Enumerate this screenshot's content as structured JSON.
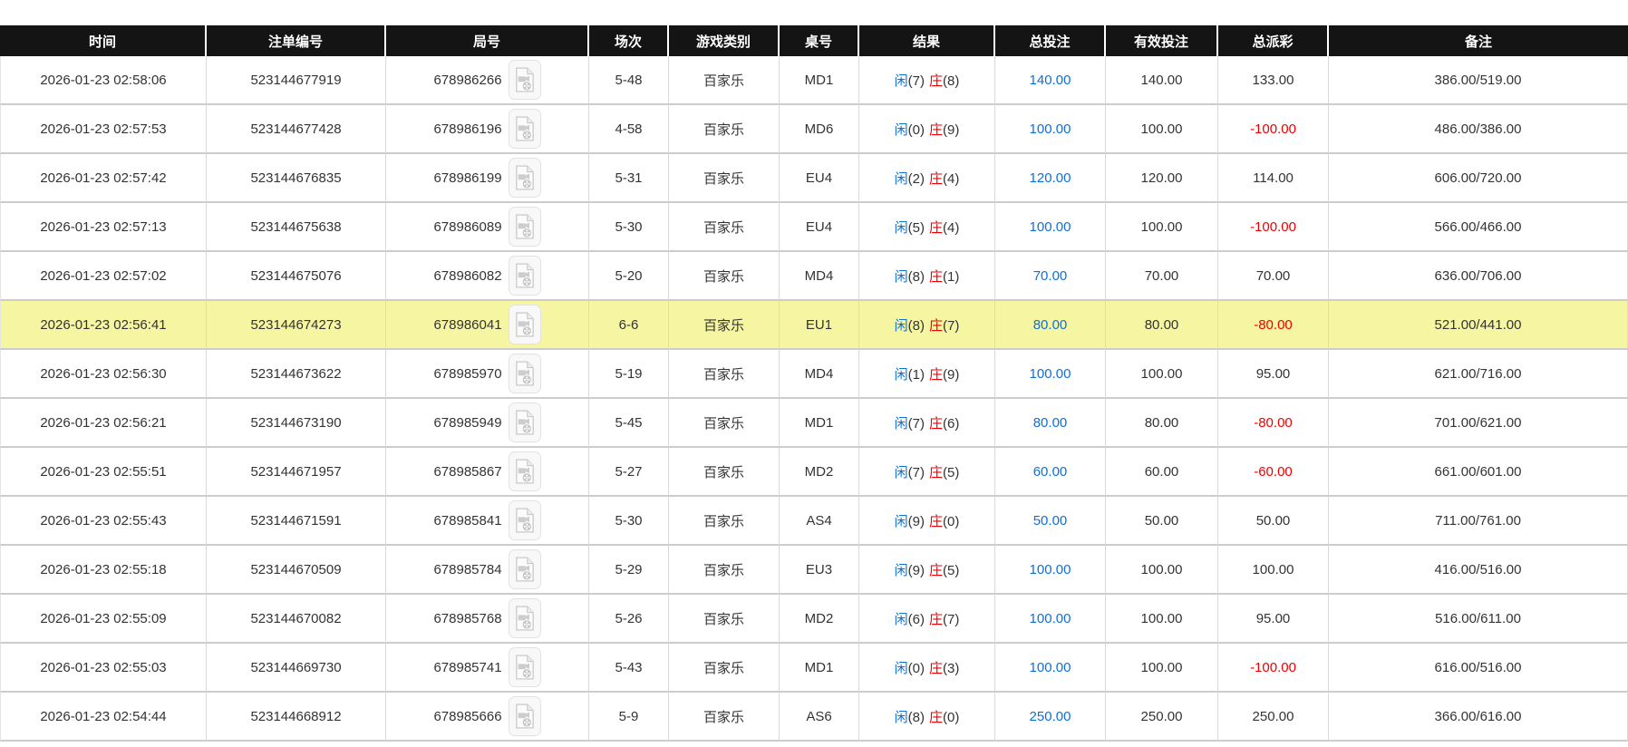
{
  "colors": {
    "header_bg": "#141414",
    "header_text": "#ffffff",
    "link_blue": "#0d6fd8",
    "zhuang_red": "#ee0000",
    "highlight_yellow": "#f6f5a1",
    "body_text": "#333333",
    "row_border": "#cccccc"
  },
  "table": {
    "columns": [
      {
        "key": "time",
        "label": "时间"
      },
      {
        "key": "bet_no",
        "label": "注单编号"
      },
      {
        "key": "round_no",
        "label": "局号"
      },
      {
        "key": "session",
        "label": "场次"
      },
      {
        "key": "game_type",
        "label": "游戏类别"
      },
      {
        "key": "table_no",
        "label": "桌号"
      },
      {
        "key": "result",
        "label": "结果"
      },
      {
        "key": "total_bet",
        "label": "总投注"
      },
      {
        "key": "valid_bet",
        "label": "有效投注"
      },
      {
        "key": "total_payout",
        "label": "总派彩"
      },
      {
        "key": "remark",
        "label": "备注"
      }
    ],
    "result_labels": {
      "player": "闲",
      "banker": "庄"
    },
    "video_icon": "video-file-icon",
    "rows": [
      {
        "time": "2026-01-23 02:58:06",
        "bet_no": "523144677919",
        "round_no": "678986266",
        "session": "5-48",
        "game_type": "百家乐",
        "table_no": "MD1",
        "player_score": "7",
        "banker_score": "8",
        "total_bet": "140.00",
        "valid_bet": "140.00",
        "total_payout": "133.00",
        "remark": "386.00/519.00",
        "highlighted": false
      },
      {
        "time": "2026-01-23 02:57:53",
        "bet_no": "523144677428",
        "round_no": "678986196",
        "session": "4-58",
        "game_type": "百家乐",
        "table_no": "MD6",
        "player_score": "0",
        "banker_score": "9",
        "total_bet": "100.00",
        "valid_bet": "100.00",
        "total_payout": "-100.00",
        "remark": "486.00/386.00",
        "highlighted": false
      },
      {
        "time": "2026-01-23 02:57:42",
        "bet_no": "523144676835",
        "round_no": "678986199",
        "session": "5-31",
        "game_type": "百家乐",
        "table_no": "EU4",
        "player_score": "2",
        "banker_score": "4",
        "total_bet": "120.00",
        "valid_bet": "120.00",
        "total_payout": "114.00",
        "remark": "606.00/720.00",
        "highlighted": false
      },
      {
        "time": "2026-01-23 02:57:13",
        "bet_no": "523144675638",
        "round_no": "678986089",
        "session": "5-30",
        "game_type": "百家乐",
        "table_no": "EU4",
        "player_score": "5",
        "banker_score": "4",
        "total_bet": "100.00",
        "valid_bet": "100.00",
        "total_payout": "-100.00",
        "remark": "566.00/466.00",
        "highlighted": false
      },
      {
        "time": "2026-01-23 02:57:02",
        "bet_no": "523144675076",
        "round_no": "678986082",
        "session": "5-20",
        "game_type": "百家乐",
        "table_no": "MD4",
        "player_score": "8",
        "banker_score": "1",
        "total_bet": "70.00",
        "valid_bet": "70.00",
        "total_payout": "70.00",
        "remark": "636.00/706.00",
        "highlighted": false
      },
      {
        "time": "2026-01-23 02:56:41",
        "bet_no": "523144674273",
        "round_no": "678986041",
        "session": "6-6",
        "game_type": "百家乐",
        "table_no": "EU1",
        "player_score": "8",
        "banker_score": "7",
        "total_bet": "80.00",
        "valid_bet": "80.00",
        "total_payout": "-80.00",
        "remark": "521.00/441.00",
        "highlighted": true
      },
      {
        "time": "2026-01-23 02:56:30",
        "bet_no": "523144673622",
        "round_no": "678985970",
        "session": "5-19",
        "game_type": "百家乐",
        "table_no": "MD4",
        "player_score": "1",
        "banker_score": "9",
        "total_bet": "100.00",
        "valid_bet": "100.00",
        "total_payout": "95.00",
        "remark": "621.00/716.00",
        "highlighted": false
      },
      {
        "time": "2026-01-23 02:56:21",
        "bet_no": "523144673190",
        "round_no": "678985949",
        "session": "5-45",
        "game_type": "百家乐",
        "table_no": "MD1",
        "player_score": "7",
        "banker_score": "6",
        "total_bet": "80.00",
        "valid_bet": "80.00",
        "total_payout": "-80.00",
        "remark": "701.00/621.00",
        "highlighted": false
      },
      {
        "time": "2026-01-23 02:55:51",
        "bet_no": "523144671957",
        "round_no": "678985867",
        "session": "5-27",
        "game_type": "百家乐",
        "table_no": "MD2",
        "player_score": "7",
        "banker_score": "5",
        "total_bet": "60.00",
        "valid_bet": "60.00",
        "total_payout": "-60.00",
        "remark": "661.00/601.00",
        "highlighted": false
      },
      {
        "time": "2026-01-23 02:55:43",
        "bet_no": "523144671591",
        "round_no": "678985841",
        "session": "5-30",
        "game_type": "百家乐",
        "table_no": "AS4",
        "player_score": "9",
        "banker_score": "0",
        "total_bet": "50.00",
        "valid_bet": "50.00",
        "total_payout": "50.00",
        "remark": "711.00/761.00",
        "highlighted": false
      },
      {
        "time": "2026-01-23 02:55:18",
        "bet_no": "523144670509",
        "round_no": "678985784",
        "session": "5-29",
        "game_type": "百家乐",
        "table_no": "EU3",
        "player_score": "9",
        "banker_score": "5",
        "total_bet": "100.00",
        "valid_bet": "100.00",
        "total_payout": "100.00",
        "remark": "416.00/516.00",
        "highlighted": false
      },
      {
        "time": "2026-01-23 02:55:09",
        "bet_no": "523144670082",
        "round_no": "678985768",
        "session": "5-26",
        "game_type": "百家乐",
        "table_no": "MD2",
        "player_score": "6",
        "banker_score": "7",
        "total_bet": "100.00",
        "valid_bet": "100.00",
        "total_payout": "95.00",
        "remark": "516.00/611.00",
        "highlighted": false
      },
      {
        "time": "2026-01-23 02:55:03",
        "bet_no": "523144669730",
        "round_no": "678985741",
        "session": "5-43",
        "game_type": "百家乐",
        "table_no": "MD1",
        "player_score": "0",
        "banker_score": "3",
        "total_bet": "100.00",
        "valid_bet": "100.00",
        "total_payout": "-100.00",
        "remark": "616.00/516.00",
        "highlighted": false
      },
      {
        "time": "2026-01-23 02:54:44",
        "bet_no": "523144668912",
        "round_no": "678985666",
        "session": "5-9",
        "game_type": "百家乐",
        "table_no": "AS6",
        "player_score": "8",
        "banker_score": "0",
        "total_bet": "250.00",
        "valid_bet": "250.00",
        "total_payout": "250.00",
        "remark": "366.00/616.00",
        "highlighted": false
      }
    ]
  }
}
